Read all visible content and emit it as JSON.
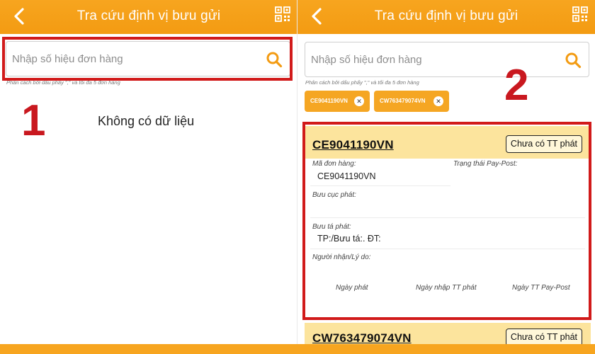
{
  "left_screen": {
    "title": "Tra cứu định vị bưu gửi",
    "search_placeholder": "Nhập số hiệu đơn hàng",
    "hint": "Phân cách bởi dấu phẩy \",\" và tối đa 5 đơn hàng",
    "empty_message": "Không có dữ liệu",
    "step_label": "1"
  },
  "right_screen": {
    "title": "Tra cứu định vị bưu gửi",
    "search_placeholder": "Nhập số hiệu đơn hàng",
    "hint": "Phân cách bởi dấu phẩy \",\" và tối đa 5 đơn hàng",
    "step_label": "2",
    "chips": [
      {
        "label": "CE9041190VN",
        "remove": "✕"
      },
      {
        "label": "CW763479074VN",
        "remove": "✕"
      }
    ],
    "results": [
      {
        "code": "CE9041190VN",
        "status": "Chưa có TT phát",
        "labels": {
          "order_code": "Mã đơn hàng:",
          "paypost_status": "Trạng thái Pay-Post:",
          "post_office": "Bưu cục phát:",
          "postman": "Bưu tá phát:",
          "recipient": "Người nhận/Lý do:"
        },
        "values": {
          "order_code": "CE9041190VN",
          "postman": "TP:/Bưu tá:. ĐT:"
        },
        "footer": [
          "Ngày phát",
          "Ngày nhập TT phát",
          "Ngày TT Pay-Post"
        ]
      },
      {
        "code": "CW763479074VN",
        "status": "Chưa có TT phát"
      }
    ]
  },
  "icons": {
    "back": "chevron-left-icon",
    "qr": "qr-code-icon",
    "search": "search-icon",
    "close": "close-icon"
  },
  "colors": {
    "header": "#f7a51f",
    "chip": "#f5a623",
    "card_header": "#fce49d",
    "highlight": "#d11a1a"
  }
}
